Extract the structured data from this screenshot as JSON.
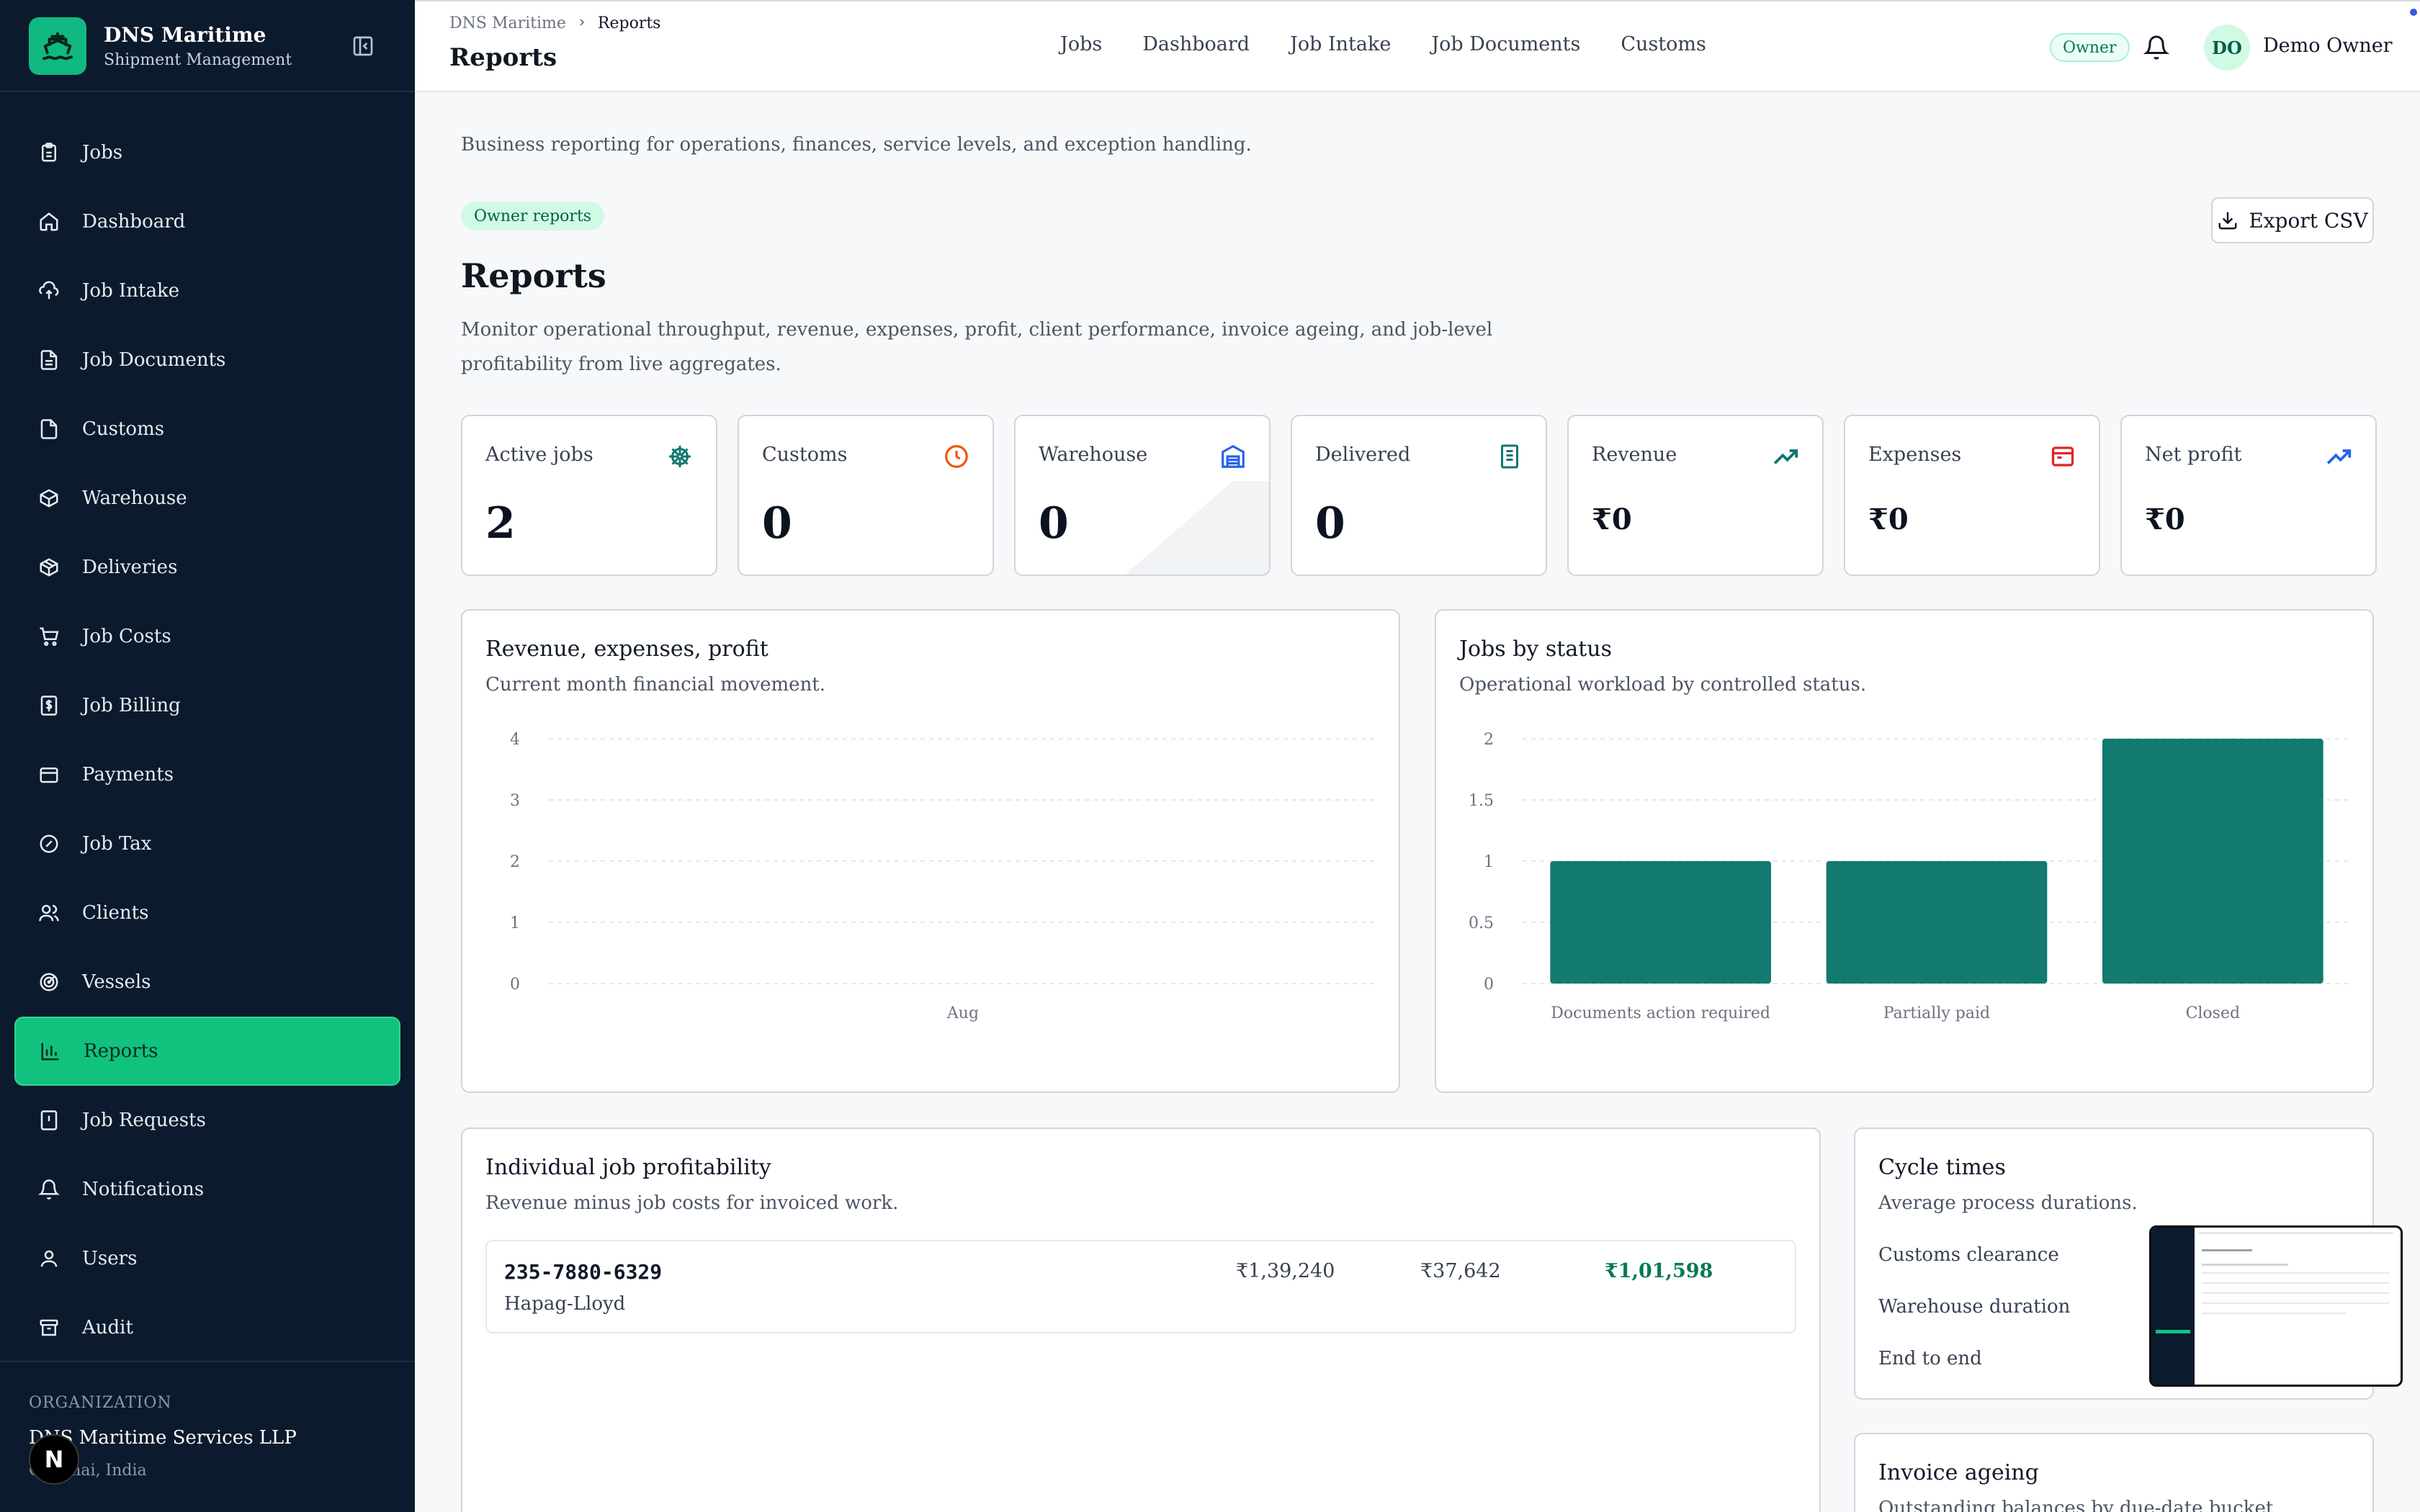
{
  "brand": {
    "name": "DNS Maritime",
    "subtitle": "Shipment Management"
  },
  "sidebar": {
    "items": [
      {
        "label": "Jobs",
        "icon": "clipboard-icon"
      },
      {
        "label": "Dashboard",
        "icon": "home-icon"
      },
      {
        "label": "Job Intake",
        "icon": "cloud-upload-icon"
      },
      {
        "label": "Job Documents",
        "icon": "file-icon"
      },
      {
        "label": "Customs",
        "icon": "document-icon"
      },
      {
        "label": "Warehouse",
        "icon": "box-icon"
      },
      {
        "label": "Deliveries",
        "icon": "package-icon"
      },
      {
        "label": "Job Costs",
        "icon": "cart-icon"
      },
      {
        "label": "Job Billing",
        "icon": "receipt-dollar-icon"
      },
      {
        "label": "Payments",
        "icon": "wallet-icon"
      },
      {
        "label": "Job Tax",
        "icon": "percent-badge-icon"
      },
      {
        "label": "Clients",
        "icon": "users-icon"
      },
      {
        "label": "Vessels",
        "icon": "radar-icon"
      },
      {
        "label": "Reports",
        "icon": "bar-chart-icon",
        "active": true
      },
      {
        "label": "Job Requests",
        "icon": "alert-file-icon"
      },
      {
        "label": "Notifications",
        "icon": "bell-icon"
      },
      {
        "label": "Users",
        "icon": "user-icon"
      },
      {
        "label": "Audit",
        "icon": "archive-icon"
      }
    ],
    "org_label": "ORGANIZATION",
    "org_name": "DNS Maritime Services LLP",
    "org_location": "Chennai, India"
  },
  "header": {
    "breadcrumb": [
      "DNS Maritime",
      "Reports"
    ],
    "title": "Reports",
    "nav": [
      "Jobs",
      "Dashboard",
      "Job Intake",
      "Job Documents",
      "Customs"
    ],
    "role_badge": "Owner",
    "avatar_initials": "DO",
    "user_name": "Demo Owner"
  },
  "main": {
    "description": "Business reporting for operations, finances, service levels, and exception handling.",
    "badge": "Owner reports",
    "export_label": "Export CSV",
    "title": "Reports",
    "subtitle": "Monitor operational throughput, revenue, expenses, profit, client performance, invoice ageing, and job-level profitability from live aggregates."
  },
  "kpis": [
    {
      "label": "Active jobs",
      "value": "2",
      "icon": "ship-wheel-icon",
      "color": "#0f766e"
    },
    {
      "label": "Customs",
      "value": "0",
      "icon": "clock-icon",
      "color": "#ea580c"
    },
    {
      "label": "Warehouse",
      "value": "0",
      "icon": "warehouse-icon",
      "color": "#2563eb"
    },
    {
      "label": "Delivered",
      "value": "0",
      "icon": "receipt-icon",
      "color": "#0f766e"
    },
    {
      "label": "Revenue",
      "value": "₹0",
      "icon": "trending-up-icon",
      "color": "#0f766e"
    },
    {
      "label": "Expenses",
      "value": "₹0",
      "icon": "wallet-red-icon",
      "color": "#dc2626"
    },
    {
      "label": "Net profit",
      "value": "₹0",
      "icon": "trending-up-blue-icon",
      "color": "#2563eb"
    }
  ],
  "finance_card": {
    "title": "Revenue, expenses, profit",
    "subtitle": "Current month financial movement.",
    "chart_data": {
      "type": "line",
      "categories": [
        "Aug"
      ],
      "series": [],
      "ylim": [
        0,
        4
      ],
      "yticks": [
        "0",
        "1",
        "2",
        "3",
        "4"
      ]
    }
  },
  "status_card": {
    "title": "Jobs by status",
    "subtitle": "Operational workload by controlled status.",
    "chart_data": {
      "type": "bar",
      "categories": [
        "Documents action required",
        "Partially paid",
        "Closed"
      ],
      "values": [
        1,
        1,
        2
      ],
      "ylim": [
        0,
        2
      ],
      "yticks": [
        "0",
        "0.5",
        "1",
        "1.5",
        "2"
      ],
      "color": "#127a6e"
    }
  },
  "profitability": {
    "title": "Individual job profitability",
    "subtitle": "Revenue minus job costs for invoiced work.",
    "rows": [
      {
        "job": "235-7880-6329",
        "client": "Hapag-Lloyd",
        "revenue": "₹1,39,240",
        "cost": "₹37,642",
        "profit": "₹1,01,598"
      }
    ]
  },
  "cycle": {
    "title": "Cycle times",
    "subtitle": "Average process durations.",
    "items": [
      "Customs clearance",
      "Warehouse duration",
      "End to end"
    ]
  },
  "ageing": {
    "title": "Invoice ageing",
    "subtitle": "Outstanding balances by due-date bucket."
  }
}
